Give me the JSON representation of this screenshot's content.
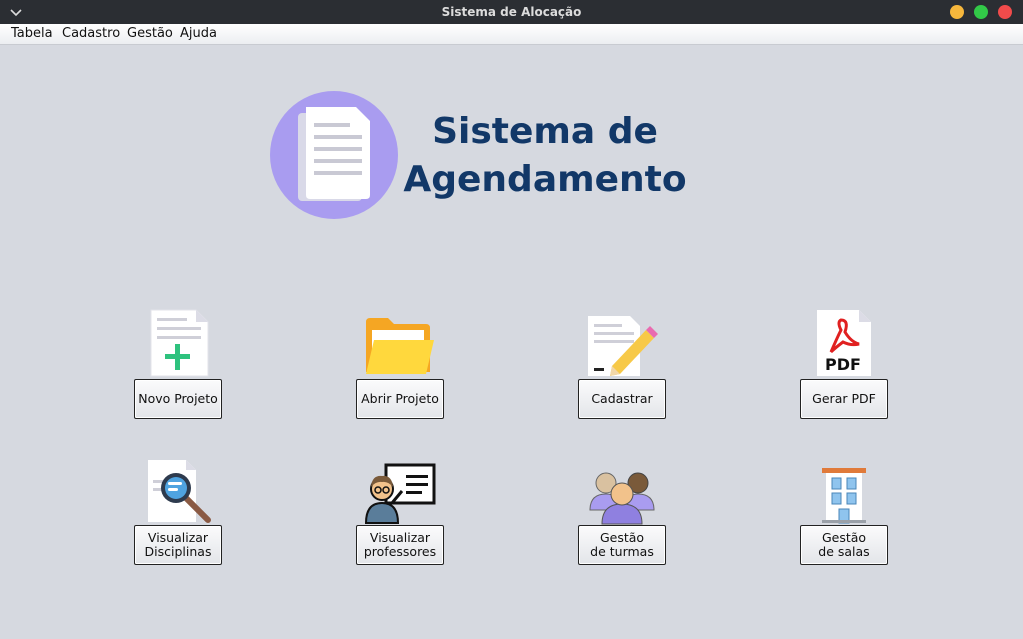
{
  "window": {
    "title": "Sistema de Alocação",
    "controls": {
      "minimize_color": "#f6b73c",
      "maximize_color": "#32c948",
      "close_color": "#f14b4b"
    }
  },
  "menubar": {
    "items": [
      "Tabela",
      "Cadastro",
      "Gestão",
      "Ajuda"
    ]
  },
  "header": {
    "title_line1": "Sistema de",
    "title_line2": "Agendamento",
    "logo_icon": "document-icon",
    "logo_color": "#a99cf0",
    "title_color": "#123868"
  },
  "actions": [
    {
      "label": "Novo Projeto",
      "icon": "new-document-icon"
    },
    {
      "label": "Abrir Projeto",
      "icon": "folder-icon"
    },
    {
      "label": "Cadastrar",
      "icon": "edit-document-icon"
    },
    {
      "label": "Gerar PDF",
      "icon": "pdf-icon"
    },
    {
      "label": "Visualizar\nDisciplinas",
      "icon": "search-document-icon"
    },
    {
      "label": "Visualizar\nprofessores",
      "icon": "teacher-icon"
    },
    {
      "label": "Gestão\nde turmas",
      "icon": "group-icon"
    },
    {
      "label": "Gestão\nde salas",
      "icon": "building-icon"
    }
  ]
}
